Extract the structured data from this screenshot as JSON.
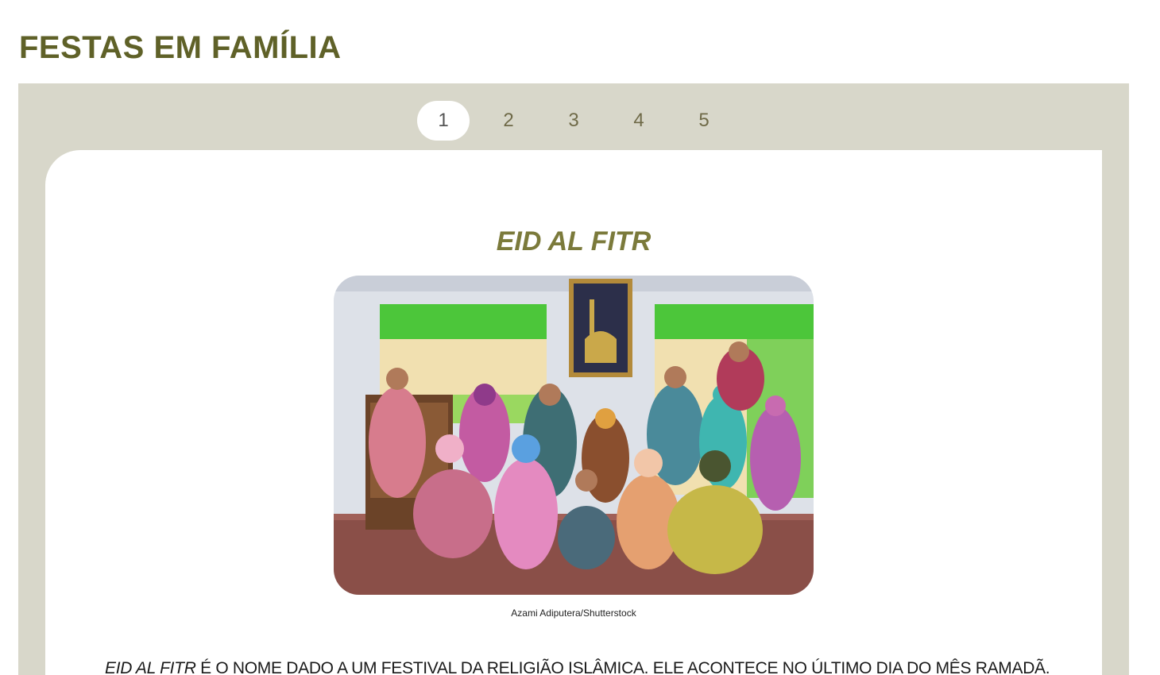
{
  "page": {
    "title": "FESTAS EM FAMÍLIA"
  },
  "pagination": {
    "active": "1",
    "items": [
      "1",
      "2",
      "3",
      "4",
      "5"
    ]
  },
  "slide": {
    "title": "EID AL FITR",
    "photo_credit": "Azami Adiputera/Shutterstock",
    "body_term": "EID AL FITR",
    "body_rest": " É O NOME DADO A UM FESTIVAL DA RELIGIÃO ISLÂMICA. ELE ACONTECE NO ÚLTIMO DIA DO MÊS RAMADÃ."
  },
  "colors": {
    "title": "#5f6128",
    "slide_title": "#7b7a3b",
    "carousel_bg": "#d8d7ca",
    "card_bg": "#ffffff"
  }
}
